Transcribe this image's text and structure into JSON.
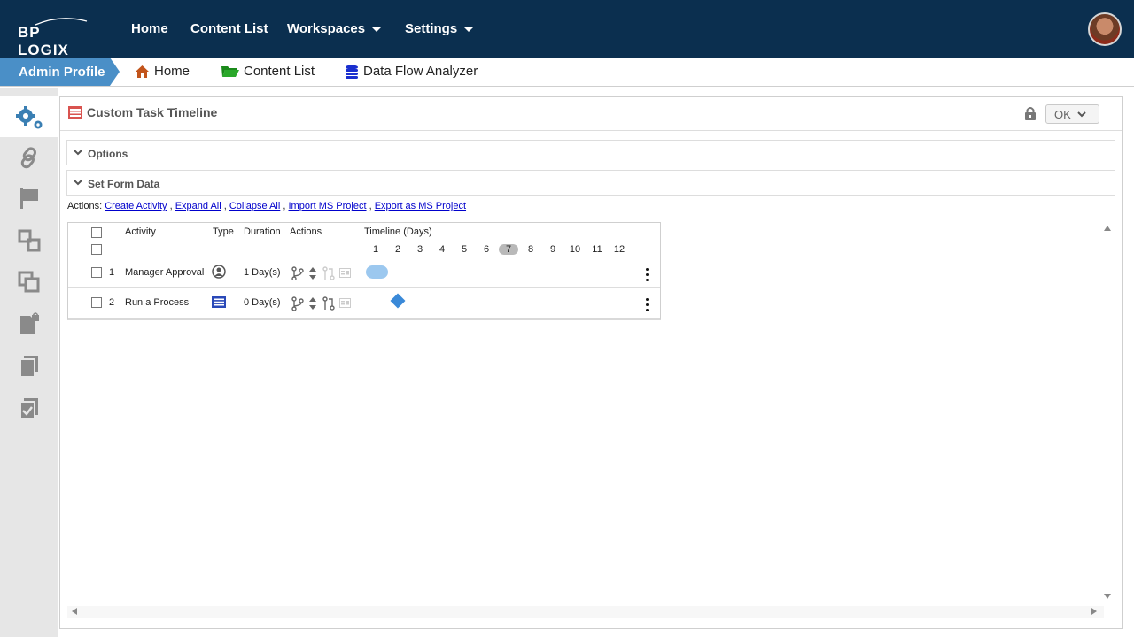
{
  "brand": {
    "logo_text": "BP LOGIX"
  },
  "topnav": {
    "items": [
      {
        "label": "Home"
      },
      {
        "label": "Content List"
      },
      {
        "label": "Workspaces"
      },
      {
        "label": "Settings"
      }
    ]
  },
  "breadcrumb": {
    "active": "Admin Profile",
    "items": [
      {
        "label": "Home",
        "icon": "home-icon"
      },
      {
        "label": "Content List",
        "icon": "folder-icon"
      },
      {
        "label": "Data Flow Analyzer",
        "icon": "database-icon"
      }
    ]
  },
  "sidebar": {
    "icons": [
      "gears-icon",
      "link-icon",
      "flag-icon",
      "workflow-icon",
      "copy-icon",
      "locked-document-icon",
      "documents-icon",
      "task-icon"
    ]
  },
  "panel": {
    "title": "Custom Task Timeline",
    "ok_label": "OK",
    "sections": [
      {
        "label": "Options"
      },
      {
        "label": "Set Form Data"
      }
    ],
    "actions_prefix": "Actions:",
    "actions": [
      "Create Activity",
      "Expand All",
      "Collapse All",
      "Import MS Project",
      "Export as MS Project"
    ]
  },
  "gantt": {
    "headers": {
      "activity": "Activity",
      "type": "Type",
      "duration": "Duration",
      "actions": "Actions",
      "timeline": "Timeline (Days)"
    },
    "days": [
      "1",
      "2",
      "3",
      "4",
      "5",
      "6",
      "7",
      "8",
      "9",
      "10",
      "11",
      "12"
    ],
    "today": "7",
    "rows": [
      {
        "num": "1",
        "activity": "Manager Approval",
        "type_icon": "user-icon",
        "duration": "1 Day(s)",
        "bar_start_day": 1,
        "bar_days": 1,
        "shape": "bar"
      },
      {
        "num": "2",
        "activity": "Run a Process",
        "type_icon": "process-icon",
        "duration": "0 Day(s)",
        "bar_start_day": 2,
        "bar_days": 0,
        "shape": "milestone"
      }
    ]
  },
  "colors": {
    "topnav": "#0b2f4f",
    "breadcrumb_active": "#4a8fc7",
    "bar": "#9cc8ef",
    "milestone": "#3a89d8",
    "link": "#0000cc"
  }
}
